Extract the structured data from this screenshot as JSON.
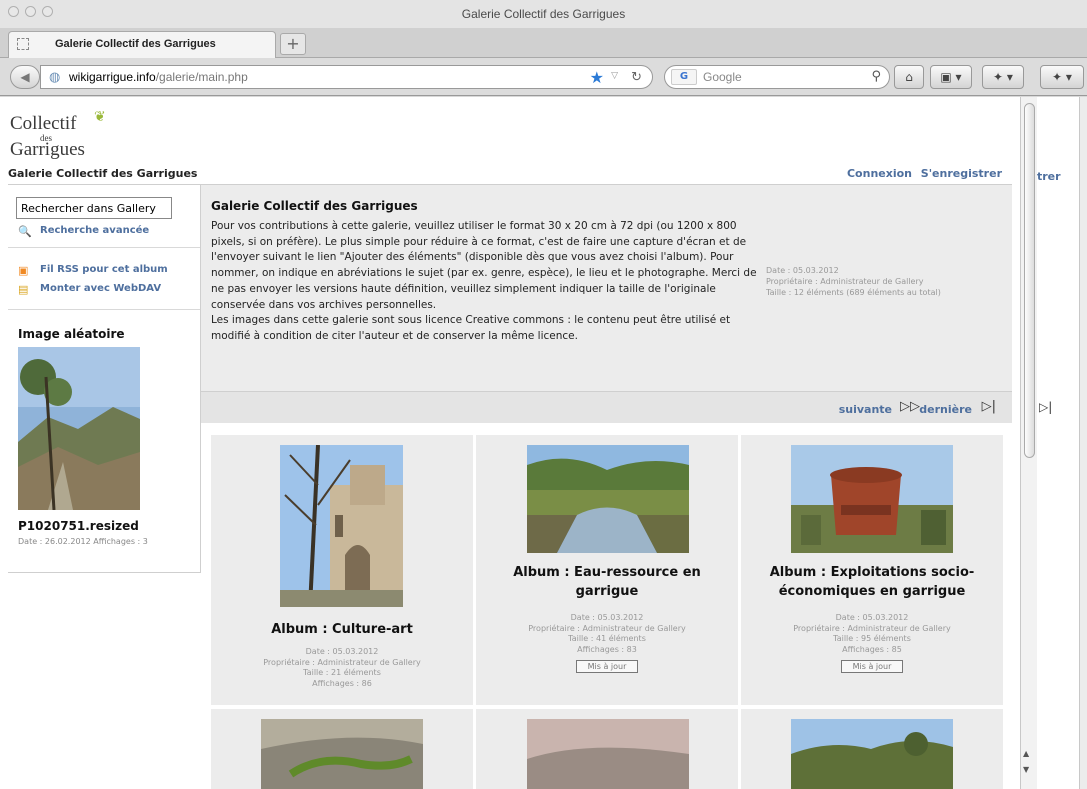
{
  "window": {
    "title": "Galerie Collectif des Garrigues"
  },
  "tab": {
    "label": "Galerie Collectif des Garrigues",
    "new_tab": "+"
  },
  "navbar": {
    "url_host": "wikigarrigue.info",
    "url_path": "/galerie/main.php",
    "search_placeholder": "Google",
    "search_engine_logo": "G"
  },
  "logo": {
    "line1": "Collectif",
    "line2": "des",
    "line3": "Garrigues"
  },
  "header": {
    "site_title": "Galerie Collectif des Garrigues",
    "login": "Connexion",
    "register": "S'enregistrer"
  },
  "sidebar": {
    "search_value": "Rechercher dans Gallery",
    "advanced_search": "Recherche avancée",
    "rss": "Fil RSS pour cet album",
    "webdav": "Monter avec WebDAV",
    "random_title": "Image aléatoire",
    "random_name": "P1020751.resized",
    "random_meta": "Date : 26.02.2012 Affichages : 3"
  },
  "description": {
    "title": "Galerie Collectif des Garrigues",
    "text": "Pour vos contributions à cette galerie, veuillez utiliser le format 30 x 20 cm à 72 dpi (ou 1200 x 800 pixels, si on préfère). Le plus simple pour réduire à ce format, c'est de faire une capture d'écran et de l'envoyer suivant le lien \"Ajouter des éléments\" (disponible dès que vous avez choisi l'album). Pour nommer, on indique en abréviations le sujet (par ex. genre, espèce), le lieu et le photographe. Merci de ne pas envoyer les versions haute définition, veuillez simplement indiquer la taille de l'originale conservée dans vos archives personnelles.",
    "text2": "Les images dans cette galerie sont sous licence Creative commons : le contenu peut être utilisé et modifié à condition de citer l'auteur et de conserver la même licence.",
    "meta_date": "Date : 05.03.2012",
    "meta_owner": "Propriétaire : Administrateur de Gallery",
    "meta_size": "Taille : 12 éléments (689 éléments au total)"
  },
  "pager": {
    "next": "suivante",
    "last": "dernière"
  },
  "albums": [
    {
      "title": "Album : Culture-art",
      "date": "Date : 05.03.2012",
      "owner": "Propriétaire : Administrateur de Gallery",
      "size": "Taille : 21 éléments",
      "views": "Affichages : 86"
    },
    {
      "title": "Album : Eau-ressource en garrigue",
      "date": "Date : 05.03.2012",
      "owner": "Propriétaire : Administrateur de Gallery",
      "size": "Taille : 41 éléments",
      "views": "Affichages : 83",
      "update": "Mis à jour"
    },
    {
      "title": "Album : Exploitations socio-économiques en garrigue",
      "date": "Date : 05.03.2012",
      "owner": "Propriétaire : Administrateur de Gallery",
      "size": "Taille : 95 éléments",
      "views": "Affichages : 85",
      "update": "Mis à jour"
    }
  ],
  "ghost": {
    "register_fragment": "trer"
  }
}
